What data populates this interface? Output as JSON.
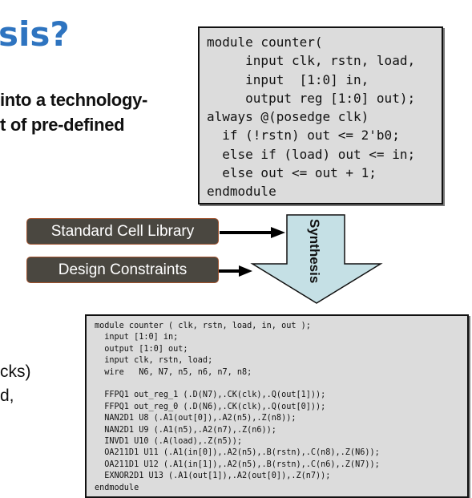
{
  "title": "sis?",
  "body": {
    "line1": "into a technology-",
    "line2": "t of pre-defined",
    "fragment1": "cks)",
    "fragment2": "d,"
  },
  "rtl_code": "module counter(\n     input clk, rstn, load,\n     input  [1:0] in,\n     output reg [1:0] out);\nalways @(posedge clk)\n  if (!rstn) out <= 2'b0;\n  else if (load) out <= in;\n  else out <= out + 1;\nendmodule",
  "inputs": {
    "library": "Standard Cell Library",
    "constraints": "Design Constraints"
  },
  "synthesis_label": "Synthesis",
  "netlist_code": "module counter ( clk, rstn, load, in, out );\n  input [1:0] in;\n  output [1:0] out;\n  input clk, rstn, load;\n  wire   N6, N7, n5, n6, n7, n8;\n\n  FFPQ1 out_reg_1 (.D(N7),.CK(clk),.Q(out[1]));\n  FFPQ1 out_reg_0 (.D(N6),.CK(clk),.Q(out[0]));\n  NAN2D1 U8 (.A1(out[0]),.A2(n5),.Z(n8));\n  NAN2D1 U9 (.A1(n5),.A2(n7),.Z(n6));\n  INVD1 U10 (.A(load),.Z(n5));\n  OA211D1 U11 (.A1(in[0]),.A2(n5),.B(rstn),.C(n8),.Z(N6));\n  OA211D1 U12 (.A1(in[1]),.A2(n5),.B(rstn),.C(n6),.Z(N7));\n  EXNOR2D1 U13 (.A1(out[1]),.A2(out[0]),.Z(n7));\nendmodule",
  "colors": {
    "title": "#2e74c0",
    "pill": "#4a4740",
    "arrow_fill": "#c5e0e5",
    "code_bg": "#dcdcdc"
  }
}
